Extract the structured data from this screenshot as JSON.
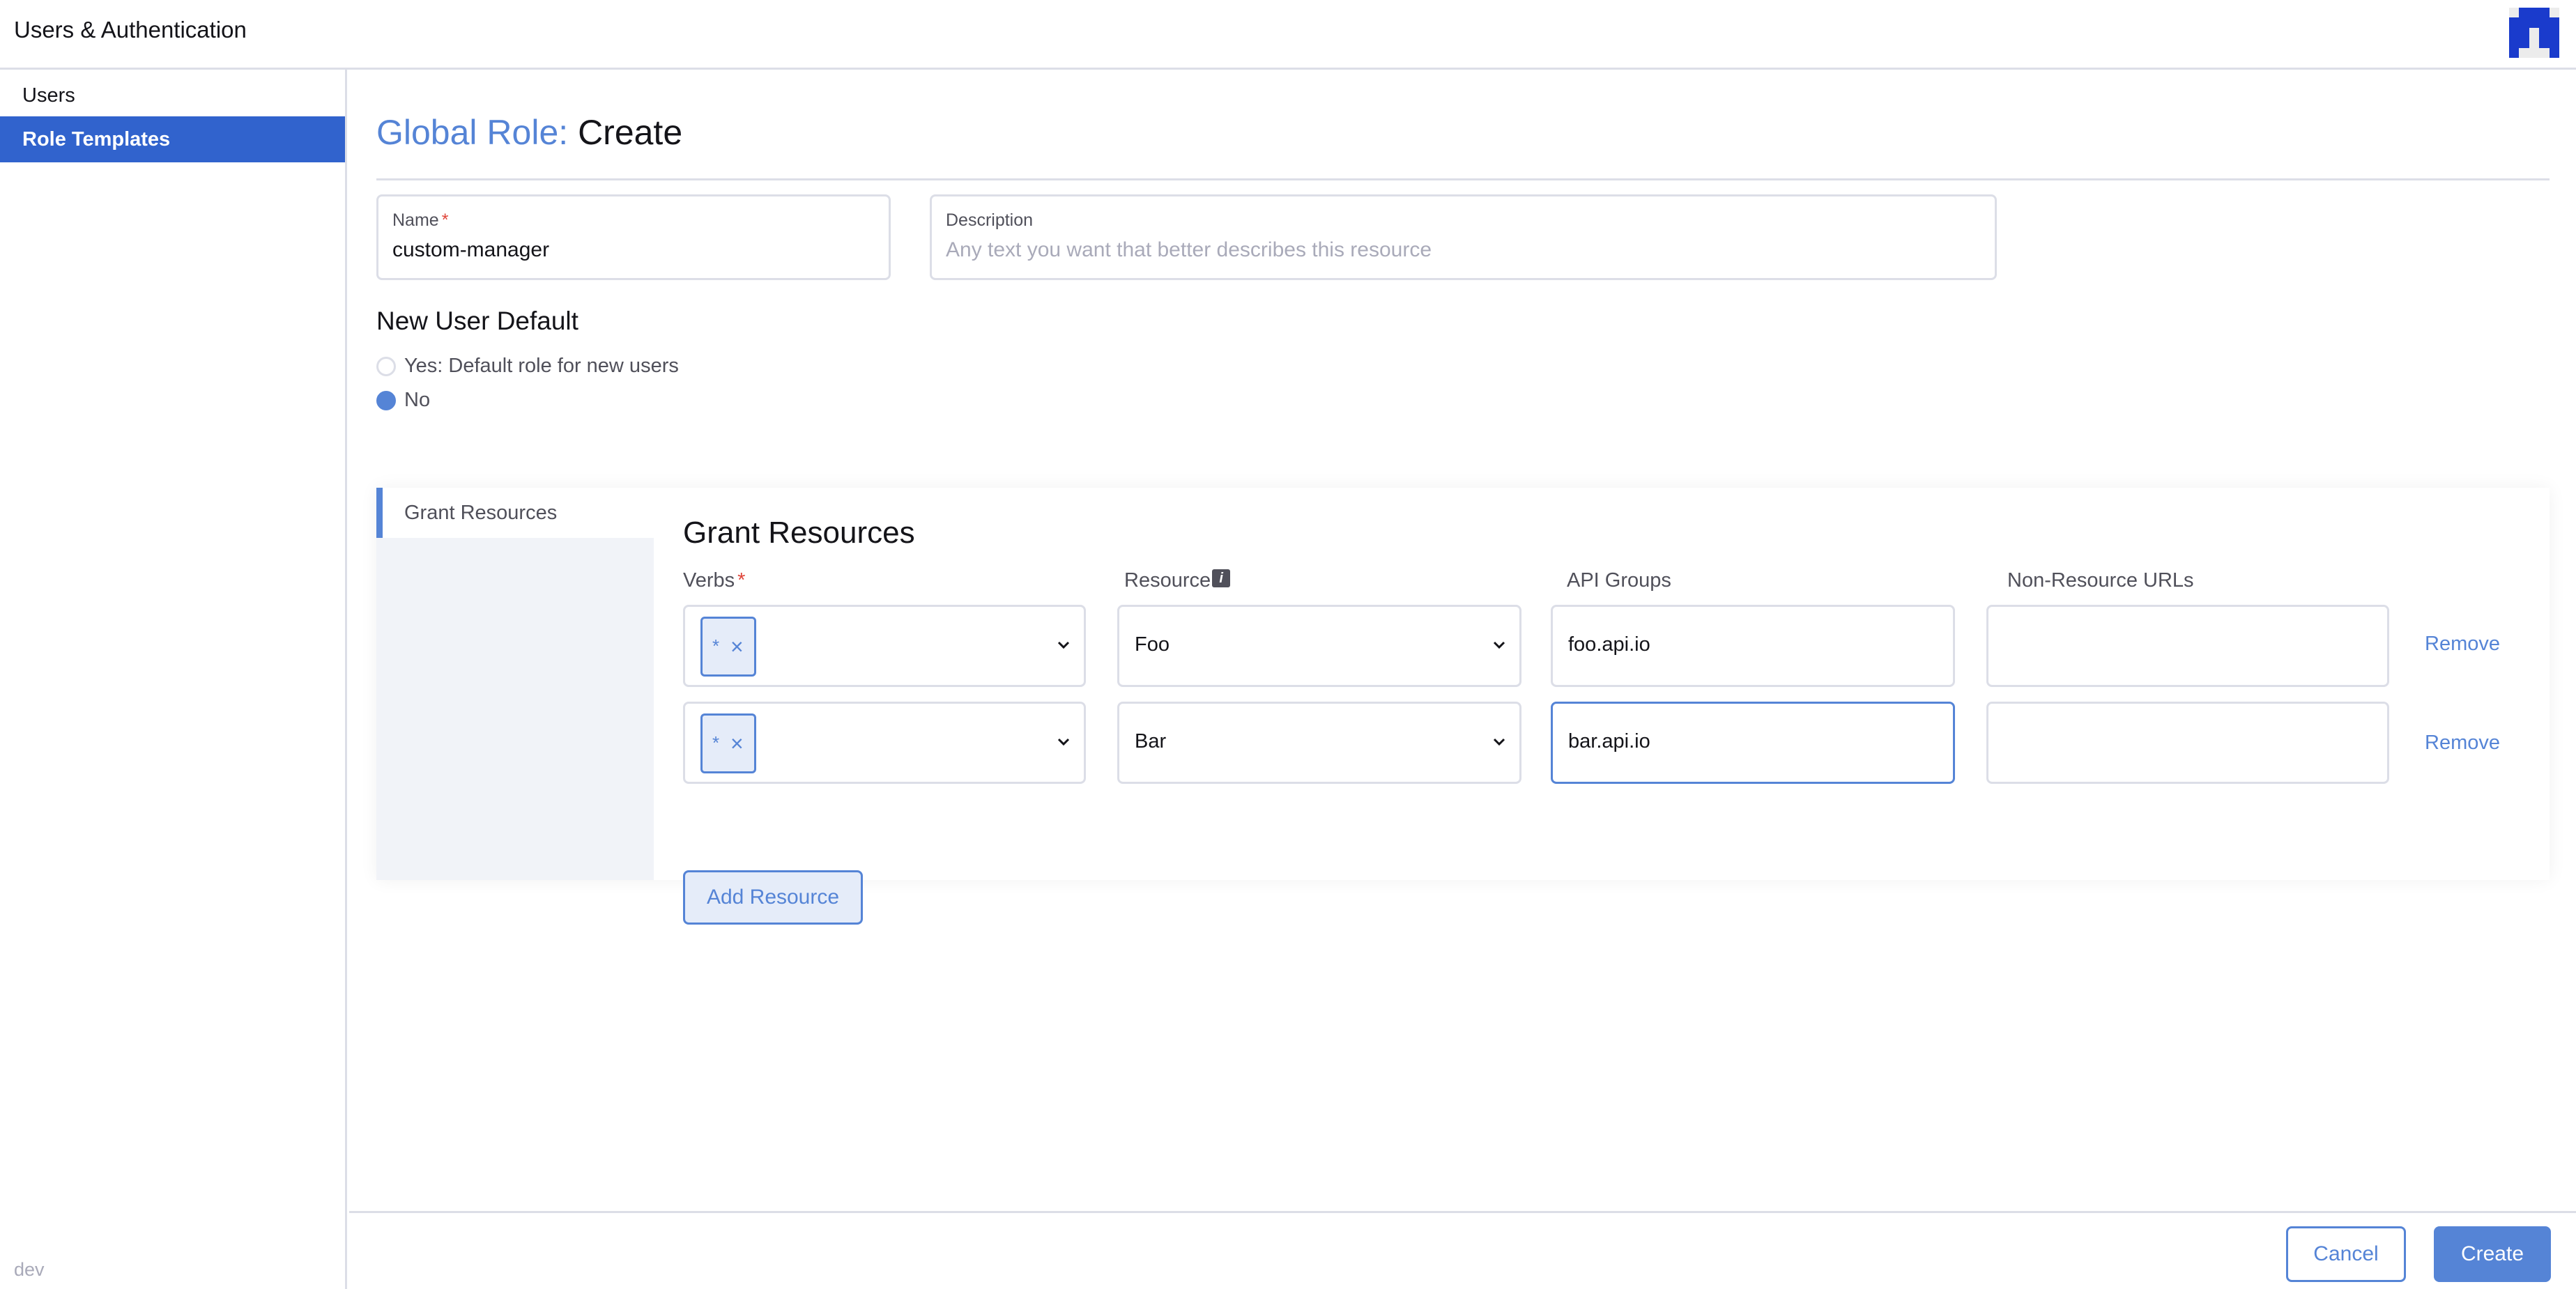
{
  "header": {
    "title": "Users & Authentication",
    "logo": "brand-logo"
  },
  "sidebar": {
    "items": [
      {
        "label": "Users",
        "active": false
      },
      {
        "label": "Role Templates",
        "active": true
      }
    ],
    "footer_label": "dev"
  },
  "page": {
    "title_prefix": "Global Role:",
    "title_action": "Create"
  },
  "form": {
    "name": {
      "label": "Name",
      "required_mark": "*",
      "value": "custom-manager"
    },
    "description": {
      "label": "Description",
      "value": "",
      "placeholder": "Any text you want that better describes this resource"
    },
    "new_user_default": {
      "heading": "New User Default",
      "options": [
        {
          "label": "Yes: Default role for new users",
          "checked": false
        },
        {
          "label": "No",
          "checked": true
        }
      ]
    }
  },
  "grant": {
    "tab_label": "Grant Resources",
    "heading": "Grant Resources",
    "columns": {
      "verbs": "Verbs",
      "verbs_required": "*",
      "resource": "Resource",
      "api_groups": "API Groups",
      "non_resource_urls": "Non-Resource URLs"
    },
    "rows": [
      {
        "verbs": [
          "*"
        ],
        "resource": "Foo",
        "api_groups": "foo.api.io",
        "non_resource_urls": "",
        "remove_label": "Remove",
        "remove_icon": "×"
      },
      {
        "verbs": [
          "*"
        ],
        "resource": "Bar",
        "api_groups": "bar.api.io",
        "non_resource_urls": "",
        "remove_label": "Remove",
        "remove_icon": "×"
      }
    ],
    "add_label": "Add Resource",
    "info_icon": "i"
  },
  "footer": {
    "cancel_label": "Cancel",
    "create_label": "Create"
  },
  "colors": {
    "accent": "#5584d6",
    "sidebar_active": "#3163cd",
    "logo": "#1a3bcc",
    "required": "#e0453a"
  }
}
